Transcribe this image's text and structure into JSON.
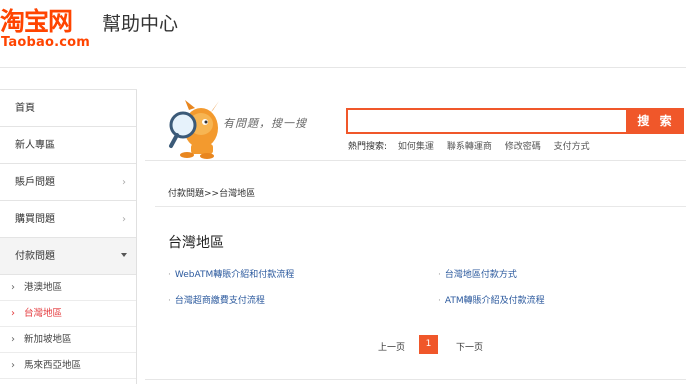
{
  "header": {
    "logo_cn": "淘宝网",
    "logo_en": "Taobao.com",
    "title": "幫助中心"
  },
  "sidebar": {
    "items": [
      {
        "label": "首頁"
      },
      {
        "label": "新人專區"
      },
      {
        "label": "賬戶問題",
        "chevron": "›"
      },
      {
        "label": "購買問題",
        "chevron": "›"
      },
      {
        "label": "付款問題"
      }
    ],
    "sub_items": [
      {
        "label": "港澳地區",
        "arrow": "›"
      },
      {
        "label": "台灣地區",
        "arrow": "›"
      },
      {
        "label": "新加坡地區",
        "arrow": "›"
      },
      {
        "label": "馬來西亞地區",
        "arrow": "›"
      }
    ]
  },
  "search": {
    "slogan": "有問題，搜一搜",
    "placeholder": "",
    "button": "搜 索",
    "hot_label": "熱門搜索:",
    "hot_links": [
      "如何集運",
      "聯系轉運商",
      "修改密碼",
      "支付方式"
    ]
  },
  "content": {
    "breadcrumb": "付款問題>>台灣地區",
    "title": "台灣地區",
    "articles": [
      "WebATM轉賬介紹和付款流程",
      "台灣地區付款方式",
      "台灣超商繳費支付流程",
      "ATM轉賬介紹及付款流程"
    ],
    "bullet": "·"
  },
  "pager": {
    "prev": "上一页",
    "current": "1",
    "next": "下一页"
  },
  "colors": {
    "brand": "#ff4400",
    "accent": "#f0572a",
    "link": "#2c5a9e",
    "active_red": "#e4393c"
  }
}
